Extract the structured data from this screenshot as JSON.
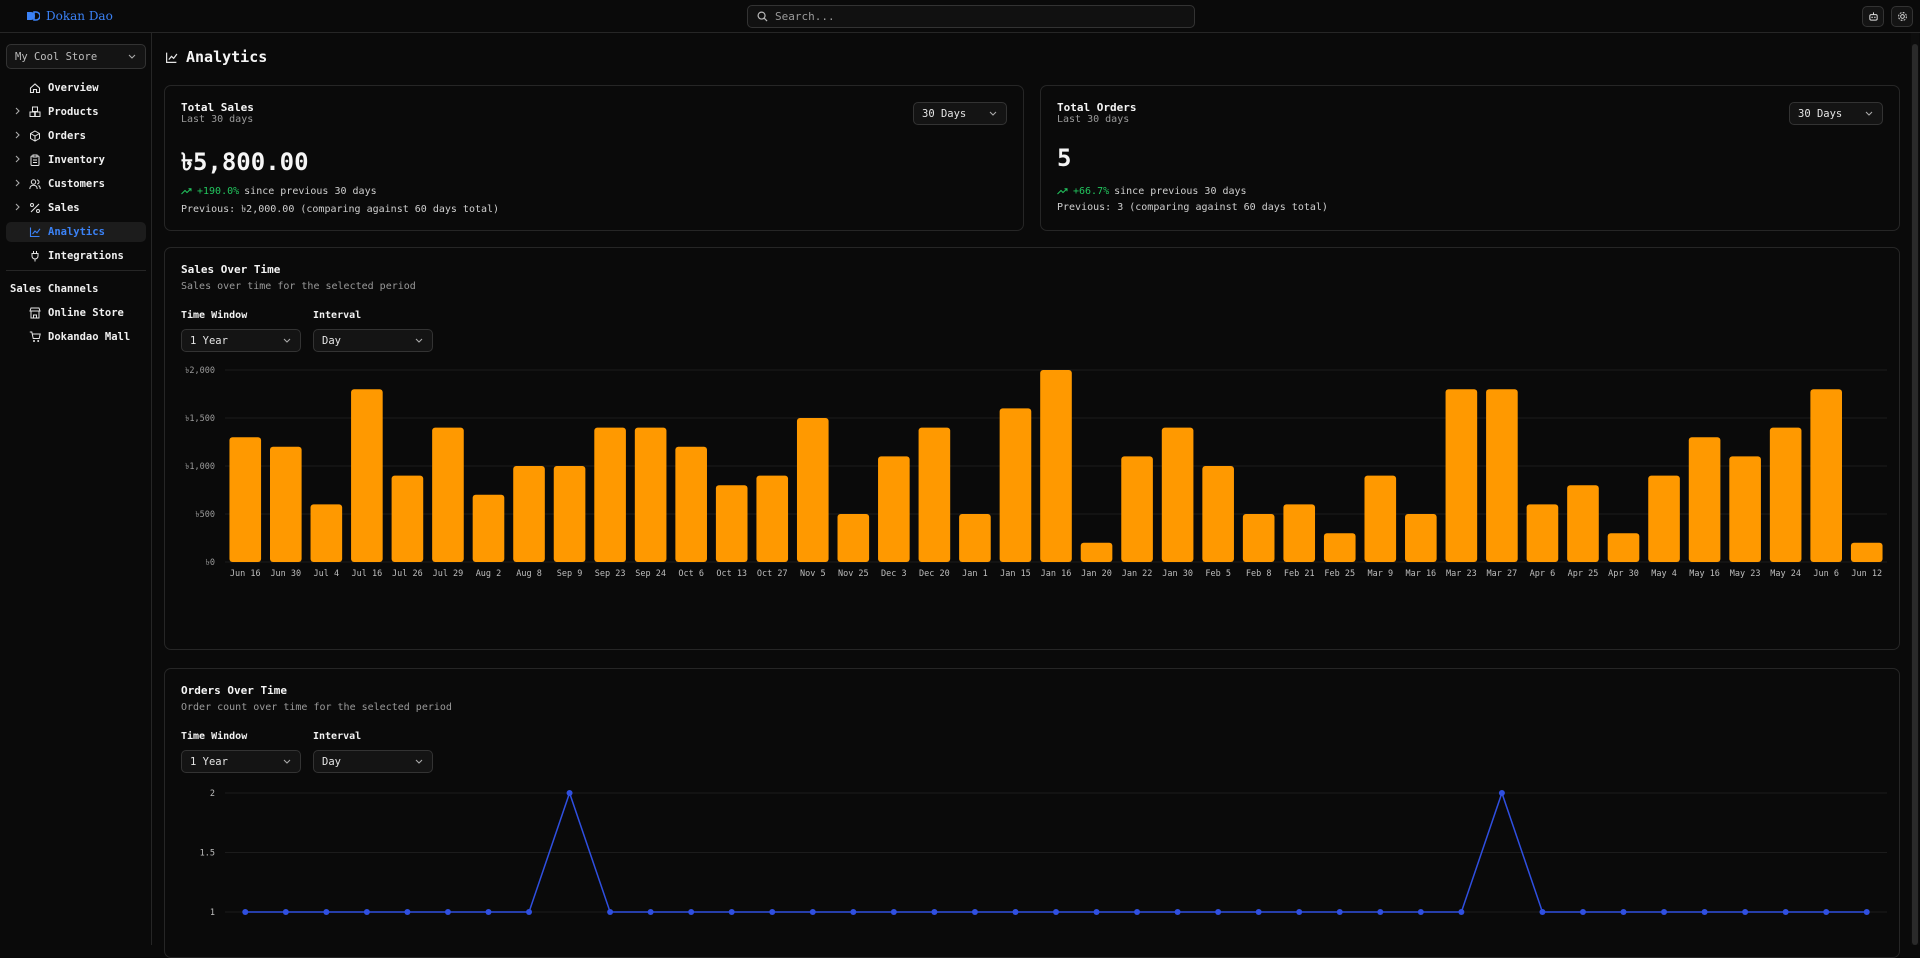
{
  "app": {
    "brand": "Dokan Dao",
    "search_placeholder": "Search..."
  },
  "sidebar": {
    "store": "My Cool Store",
    "items": [
      {
        "label": "Overview",
        "icon": "home-icon",
        "expandable": false,
        "active": false
      },
      {
        "label": "Products",
        "icon": "boxes-icon",
        "expandable": true,
        "active": false
      },
      {
        "label": "Orders",
        "icon": "package-icon",
        "expandable": true,
        "active": false
      },
      {
        "label": "Inventory",
        "icon": "clipboard-icon",
        "expandable": true,
        "active": false
      },
      {
        "label": "Customers",
        "icon": "users-icon",
        "expandable": true,
        "active": false
      },
      {
        "label": "Sales",
        "icon": "percent-icon",
        "expandable": true,
        "active": false
      },
      {
        "label": "Analytics",
        "icon": "chart-line-icon",
        "expandable": false,
        "active": true
      },
      {
        "label": "Integrations",
        "icon": "plug-icon",
        "expandable": false,
        "active": false
      }
    ],
    "channels_title": "Sales Channels",
    "channels": [
      {
        "label": "Online Store",
        "icon": "store-icon"
      },
      {
        "label": "Dokandao Mall",
        "icon": "cart-icon"
      }
    ]
  },
  "page": {
    "title": "Analytics"
  },
  "total_sales": {
    "title": "Total Sales",
    "subtitle": "Last 30 days",
    "range": "30 Days",
    "value": "৳5,800.00",
    "delta": "+190.0%",
    "delta_suffix": "since previous 30 days",
    "previous": "Previous: ৳2,000.00 (comparing against 60 days total)"
  },
  "total_orders": {
    "title": "Total Orders",
    "subtitle": "Last 30 days",
    "range": "30 Days",
    "value": "5",
    "delta": "+66.7%",
    "delta_suffix": "since previous 30 days",
    "previous": "Previous: 3 (comparing against 60 days total)"
  },
  "sales_chart": {
    "title": "Sales Over Time",
    "subtitle": "Sales over time for the selected period",
    "time_window_label": "Time Window",
    "time_window": "1 Year",
    "interval_label": "Interval",
    "interval": "Day"
  },
  "orders_chart": {
    "title": "Orders Over Time",
    "subtitle": "Order count over time for the selected period",
    "time_window_label": "Time Window",
    "time_window": "1 Year",
    "interval_label": "Interval",
    "interval": "Day"
  },
  "colors": {
    "bar": "#ff9900",
    "line": "#2f4fe0",
    "accent": "#3b82f6",
    "positive": "#22c55e"
  },
  "chart_data": [
    {
      "type": "bar",
      "title": "Sales Over Time",
      "categories": [
        "Jun 16",
        "Jun 30",
        "Jul 4",
        "Jul 16",
        "Jul 26",
        "Jul 29",
        "Aug 2",
        "Aug 8",
        "Sep 9",
        "Sep 23",
        "Sep 24",
        "Oct 6",
        "Oct 13",
        "Oct 27",
        "Nov 5",
        "Nov 25",
        "Dec 3",
        "Dec 20",
        "Jan 1",
        "Jan 15",
        "Jan 16",
        "Jan 20",
        "Jan 22",
        "Jan 30",
        "Feb 5",
        "Feb 8",
        "Feb 21",
        "Feb 25",
        "Mar 9",
        "Mar 16",
        "Mar 23",
        "Mar 27",
        "Apr 6",
        "Apr 25",
        "Apr 30",
        "May 4",
        "May 16",
        "May 23",
        "May 24",
        "Jun 6",
        "Jun 12"
      ],
      "values": [
        1300,
        1200,
        600,
        1800,
        900,
        1400,
        700,
        1000,
        1000,
        1400,
        1400,
        1200,
        800,
        900,
        1500,
        500,
        1100,
        1400,
        500,
        1600,
        2000,
        200,
        1100,
        1400,
        1000,
        500,
        600,
        300,
        900,
        500,
        1800,
        1800,
        600,
        800,
        300,
        900,
        1300,
        1100,
        1400,
        1800,
        200
      ],
      "ylim": [
        0,
        2000
      ],
      "yticks": [
        "৳0",
        "৳500",
        "৳1,000",
        "৳1,500",
        "৳2,000"
      ],
      "grid": true
    },
    {
      "type": "line",
      "title": "Orders Over Time",
      "values": [
        1,
        1,
        1,
        1,
        1,
        1,
        1,
        1,
        2,
        1,
        1,
        1,
        1,
        1,
        1,
        1,
        1,
        1,
        1,
        1,
        1,
        1,
        1,
        1,
        1,
        1,
        1,
        1,
        1,
        1,
        1,
        2,
        1,
        1,
        1,
        1,
        1,
        1,
        1,
        1,
        1
      ],
      "yticks": [
        "1",
        "1.5",
        "2"
      ],
      "ylim_visible": [
        1,
        2
      ],
      "grid": true
    }
  ]
}
